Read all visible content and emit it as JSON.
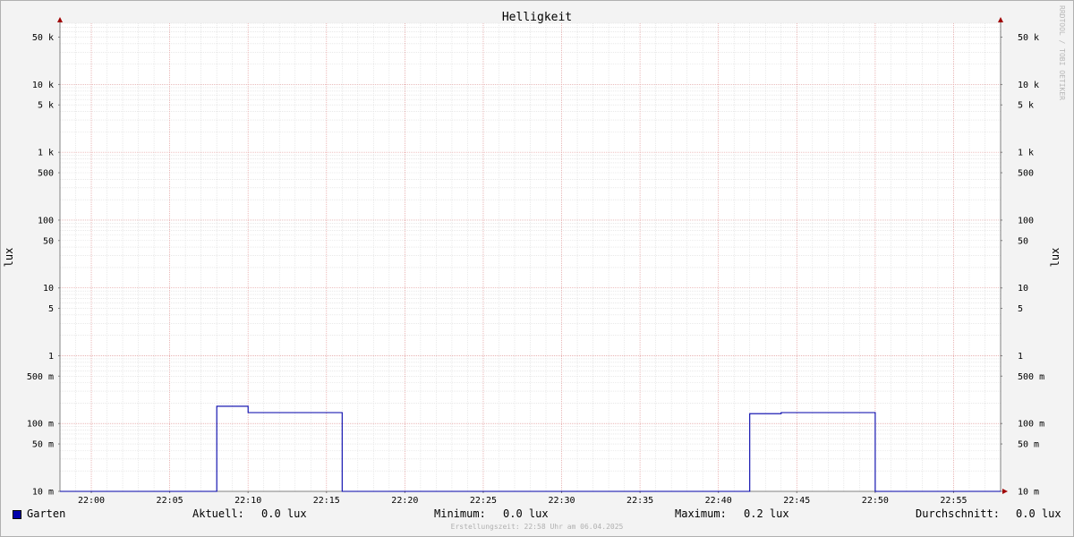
{
  "title": "Helligkeit",
  "watermark": "RRDTOOL / TOBI OETIKER",
  "footer": "Erstellungszeit: 22:58 Uhr am 06.04.2025",
  "legend": {
    "series_name": "Garten",
    "series_color": "#0000aa",
    "current_label": "Aktuell:",
    "current_value": "0.0 lux",
    "min_label": "Minimum:",
    "min_value": "0.0 lux",
    "max_label": "Maximum:",
    "max_value": "0.2 lux",
    "avg_label": "Durchschnitt:",
    "avg_value": "0.0 lux"
  },
  "chart_data": {
    "type": "line",
    "title": "Helligkeit",
    "ylabel": "lux",
    "ylabel_right": "lux",
    "y_scale": "log",
    "ylim": [
      0.01,
      80000
    ],
    "y_ticks": [
      {
        "value": 50000,
        "label": "50 k"
      },
      {
        "value": 10000,
        "label": "10 k"
      },
      {
        "value": 5000,
        "label": "5 k"
      },
      {
        "value": 1000,
        "label": "1 k"
      },
      {
        "value": 500,
        "label": "500"
      },
      {
        "value": 100,
        "label": "100"
      },
      {
        "value": 50,
        "label": "50"
      },
      {
        "value": 10,
        "label": "10"
      },
      {
        "value": 5,
        "label": "5"
      },
      {
        "value": 1,
        "label": "1"
      },
      {
        "value": 0.5,
        "label": "500 m"
      },
      {
        "value": 0.1,
        "label": "100 m"
      },
      {
        "value": 0.05,
        "label": "50 m"
      },
      {
        "value": 0.01,
        "label": "10 m"
      }
    ],
    "xlim": [
      "21:58",
      "22:58"
    ],
    "x_ticks": [
      "22:00",
      "22:05",
      "22:10",
      "22:15",
      "22:20",
      "22:25",
      "22:30",
      "22:35",
      "22:40",
      "22:45",
      "22:50",
      "22:55"
    ],
    "grid": true,
    "series": [
      {
        "name": "Garten",
        "color": "#0000aa",
        "points": [
          [
            "21:58",
            0.01
          ],
          [
            "22:08",
            0.01
          ],
          [
            "22:08",
            0.18
          ],
          [
            "22:10",
            0.18
          ],
          [
            "22:10",
            0.145
          ],
          [
            "22:16",
            0.145
          ],
          [
            "22:16",
            0.01
          ],
          [
            "22:42",
            0.01
          ],
          [
            "22:42",
            0.14
          ],
          [
            "22:44",
            0.14
          ],
          [
            "22:44",
            0.145
          ],
          [
            "22:50",
            0.145
          ],
          [
            "22:50",
            0.01
          ],
          [
            "22:58",
            0.01
          ]
        ]
      }
    ]
  }
}
